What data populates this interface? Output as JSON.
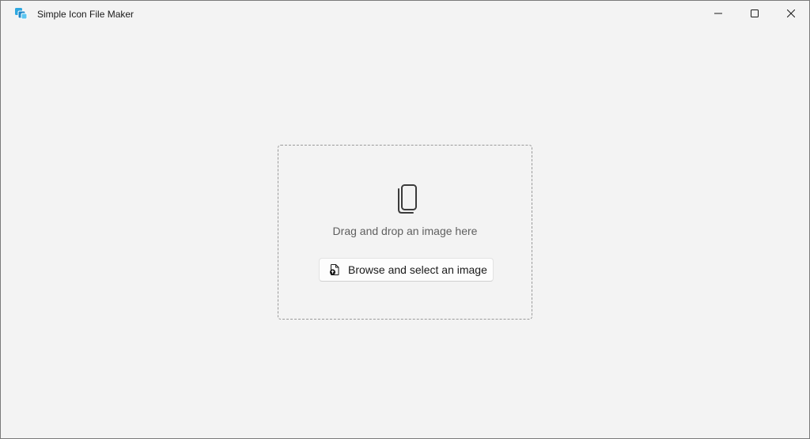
{
  "window": {
    "title": "Simple Icon File Maker",
    "app_icon": "app-logo-icon",
    "controls": {
      "minimize_icon": "minimize-icon",
      "maximize_icon": "maximize-icon",
      "close_icon": "close-icon"
    }
  },
  "dropzone": {
    "icon": "copy-documents-icon",
    "text": "Drag and drop an image here",
    "browse_button": {
      "icon": "open-file-icon",
      "label": "Browse and select an image"
    }
  },
  "colors": {
    "background": "#f3f3f3",
    "app_icon_accent": "#1e9bd7"
  }
}
